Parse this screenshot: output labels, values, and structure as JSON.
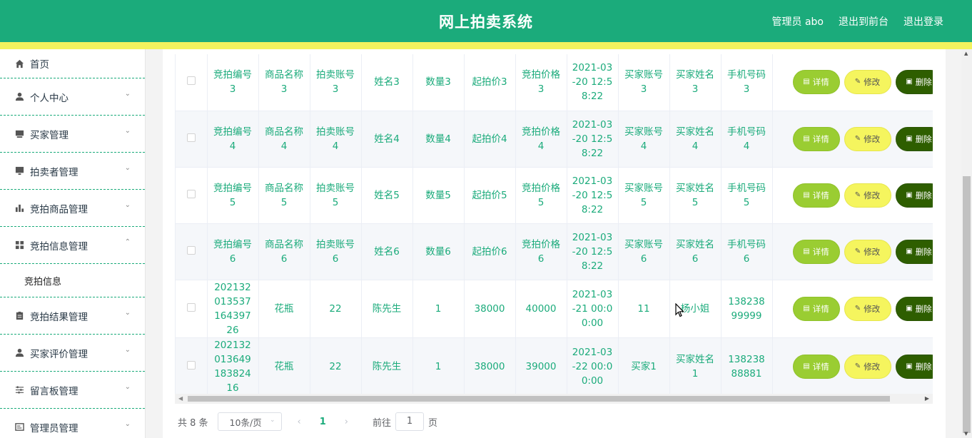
{
  "header": {
    "title": "网上拍卖系统",
    "admin_label": "管理员 abo",
    "to_frontend": "退出到前台",
    "logout": "退出登录",
    "bg_color": "#1bab7b",
    "strip_color": "#f2f25e"
  },
  "sidebar": {
    "items": [
      {
        "label": "首页",
        "icon": "home-icon"
      },
      {
        "label": "个人中心",
        "icon": "user-icon"
      },
      {
        "label": "买家管理",
        "icon": "box-icon"
      },
      {
        "label": "拍卖者管理",
        "icon": "monitor-icon"
      },
      {
        "label": "竞拍商品管理",
        "icon": "bar-chart-icon"
      },
      {
        "label": "竞拍信息管理",
        "icon": "grid-icon",
        "expanded": true
      },
      {
        "label": "竞拍结果管理",
        "icon": "clipboard-icon"
      },
      {
        "label": "买家评价管理",
        "icon": "user-icon"
      },
      {
        "label": "留言板管理",
        "icon": "sliders-icon"
      },
      {
        "label": "管理员管理",
        "icon": "id-card-icon"
      }
    ],
    "subitem": "竞拍信息"
  },
  "table": {
    "rows": [
      {
        "cells": [
          "竞拍编号3",
          "商品名称3",
          "拍卖账号3",
          "姓名3",
          "数量3",
          "起拍价3",
          "竞拍价格3",
          "2021-03-20 12:58:22",
          "买家账号3",
          "买家姓名3",
          "手机号码3"
        ]
      },
      {
        "cells": [
          "竞拍编号4",
          "商品名称4",
          "拍卖账号4",
          "姓名4",
          "数量4",
          "起拍价4",
          "竞拍价格4",
          "2021-03-20 12:58:22",
          "买家账号4",
          "买家姓名4",
          "手机号码4"
        ]
      },
      {
        "cells": [
          "竞拍编号5",
          "商品名称5",
          "拍卖账号5",
          "姓名5",
          "数量5",
          "起拍价5",
          "竞拍价格5",
          "2021-03-20 12:58:22",
          "买家账号5",
          "买家姓名5",
          "手机号码5"
        ]
      },
      {
        "cells": [
          "竞拍编号6",
          "商品名称6",
          "拍卖账号6",
          "姓名6",
          "数量6",
          "起拍价6",
          "竞拍价格6",
          "2021-03-20 12:58:22",
          "买家账号6",
          "买家姓名6",
          "手机号码6"
        ]
      },
      {
        "cells": [
          "20213201353716439726",
          "花瓶",
          "22",
          "陈先生",
          "1",
          "38000",
          "40000",
          "2021-03-21 00:00:00",
          "11",
          "杨小姐",
          "13823899999"
        ]
      },
      {
        "cells": [
          "20213201364918382416",
          "花瓶",
          "22",
          "陈先生",
          "1",
          "38000",
          "39000",
          "2021-03-22 00:00:00",
          "买家1",
          "买家姓名1",
          "13823888881"
        ]
      }
    ],
    "actions": {
      "detail": "详情",
      "edit": "修改",
      "delete": "删除"
    }
  },
  "pagination": {
    "total": "共 8 条",
    "page_size": "10条/页",
    "current_page": "1",
    "goto_label": "前往",
    "goto_value": "1",
    "goto_suffix": "页"
  }
}
